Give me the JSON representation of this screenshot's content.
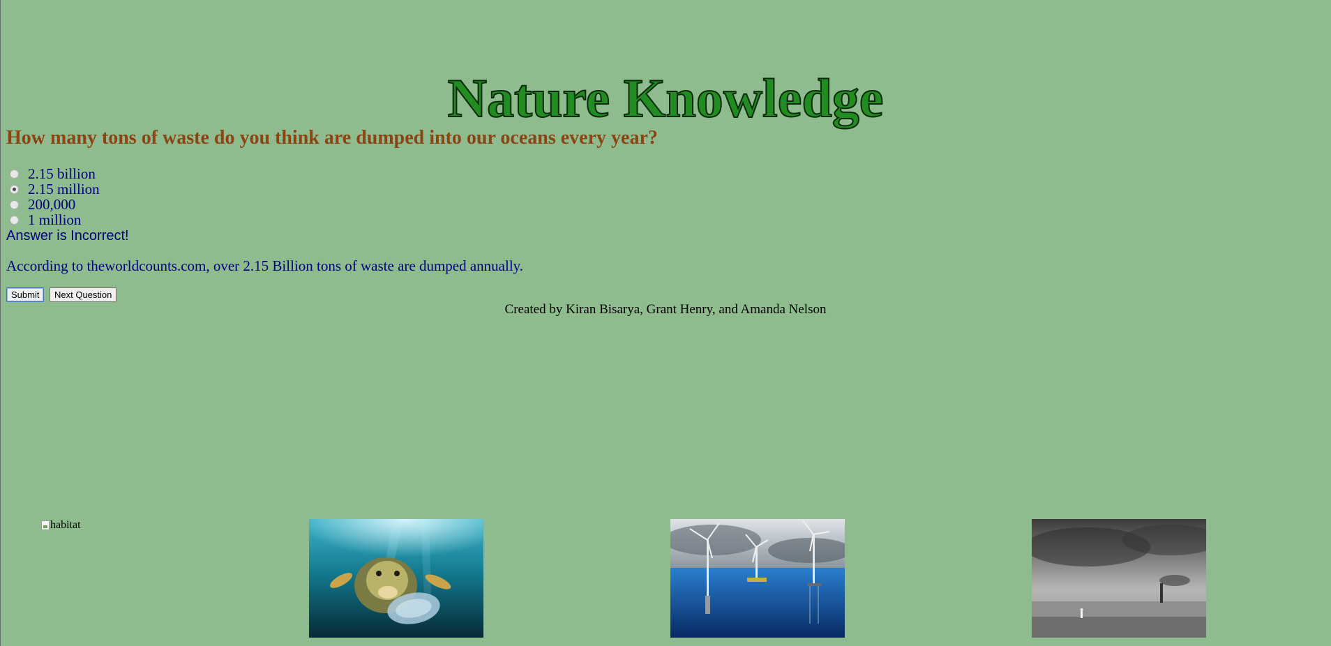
{
  "page": {
    "title": "Nature Knowledge",
    "background_color": "#8fbc8f"
  },
  "quiz": {
    "question": "How many tons of waste do you think are dumped into our oceans every year?",
    "options": [
      {
        "label": "2.15 billion",
        "selected": false
      },
      {
        "label": "2.15 million",
        "selected": true
      },
      {
        "label": "200,000",
        "selected": false
      },
      {
        "label": "1 million",
        "selected": false
      }
    ],
    "result": "Answer is Incorrect!",
    "explanation": "According to theworldcounts.com, over 2.15 Billion tons of waste are dumped annually.",
    "submit_label": "Submit",
    "next_label": "Next Question"
  },
  "footer": {
    "credits": "Created by Kiran Bisarya, Grant Henry, and Amanda Nelson"
  },
  "images": {
    "broken_alt": "habitat",
    "photos": [
      {
        "name": "sea turtle with plastic bag",
        "icon": "turtle-photo"
      },
      {
        "name": "offshore wind turbines",
        "icon": "wind-turbine-photo"
      },
      {
        "name": "industrial smokestack landscape",
        "icon": "pollution-photo"
      }
    ]
  },
  "colors": {
    "title": "#228b22",
    "question": "#8b4513",
    "body_text": "#000080"
  }
}
